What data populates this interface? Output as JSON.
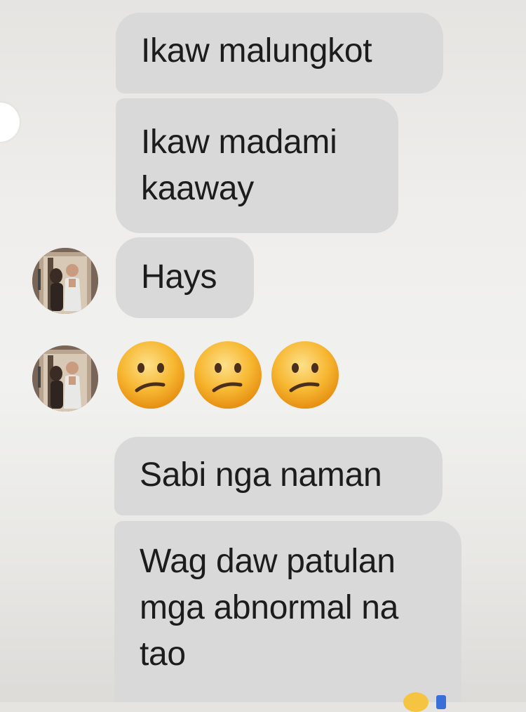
{
  "conversation": {
    "messages": [
      {
        "text": "Ikaw malungkot"
      },
      {
        "text": "Ikaw madami\nkaaway"
      },
      {
        "text": "Hays"
      },
      {
        "emoji": [
          "confused-face",
          "confused-face",
          "confused-face"
        ]
      },
      {
        "text": "Sabi nga naman"
      },
      {
        "text": "Wag daw patulan\nmga abnormal na\ntao"
      }
    ]
  },
  "colors": {
    "bubble_background": "#d9d9d9",
    "emoji_yellow": "#f7b731",
    "page_background": "#efeeec"
  }
}
